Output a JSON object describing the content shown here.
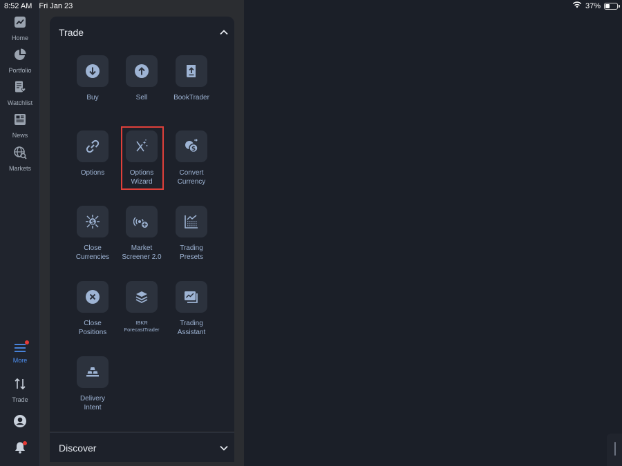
{
  "status_bar": {
    "time": "8:52 AM",
    "date": "Fri Jan 23",
    "battery": "37%",
    "battery_level": 0.37
  },
  "sidebar": {
    "items": [
      {
        "label": "Home",
        "icon": "home-chart-icon"
      },
      {
        "label": "Portfolio",
        "icon": "pie-chart-icon"
      },
      {
        "label": "Watchlist",
        "icon": "watchlist-heart-icon"
      },
      {
        "label": "News",
        "icon": "newspaper-icon"
      },
      {
        "label": "Markets",
        "icon": "globe-search-icon"
      }
    ],
    "more": {
      "label": "More",
      "icon": "hamburger-menu-icon",
      "active": true
    },
    "trade": {
      "label": "Trade",
      "icon": "up-down-arrows-icon"
    },
    "profile": {
      "icon": "user-avatar-icon"
    },
    "notifications": {
      "icon": "bell-icon"
    }
  },
  "trade_section": {
    "title": "Trade",
    "expanded": true,
    "tiles": [
      {
        "label": "Buy",
        "icon": "arrow-down-circle-icon"
      },
      {
        "label": "Sell",
        "icon": "arrow-up-circle-icon"
      },
      {
        "label": "BookTrader",
        "icon": "book-upload-icon"
      },
      {
        "label": "Options",
        "icon": "chain-link-icon"
      },
      {
        "label": "Options\nWizard",
        "icon": "magic-wand-icon",
        "highlighted": true
      },
      {
        "label": "Convert\nCurrency",
        "icon": "currency-exchange-icon"
      },
      {
        "label": "Close\nCurrencies",
        "icon": "currency-network-icon"
      },
      {
        "label": "Market\nScreener 2.0",
        "icon": "radar-plus-icon"
      },
      {
        "label": "Trading\nPresets",
        "icon": "chart-preset-icon"
      },
      {
        "label": "Close\nPositions",
        "icon": "x-circle-icon"
      },
      {
        "label": "IBKR\nForecastTrader",
        "icon": "layers-stack-icon"
      },
      {
        "label": "Trading\nAssistant",
        "icon": "chart-window-icon"
      },
      {
        "label": "Delivery\nIntent",
        "icon": "gold-bars-icon"
      }
    ]
  },
  "discover_section": {
    "title": "Discover",
    "expanded": false
  },
  "colors": {
    "accent": "#4d8ff0",
    "highlight": "#e0403a",
    "badge": "#e53935",
    "tile_label": "#9eb4d4"
  }
}
